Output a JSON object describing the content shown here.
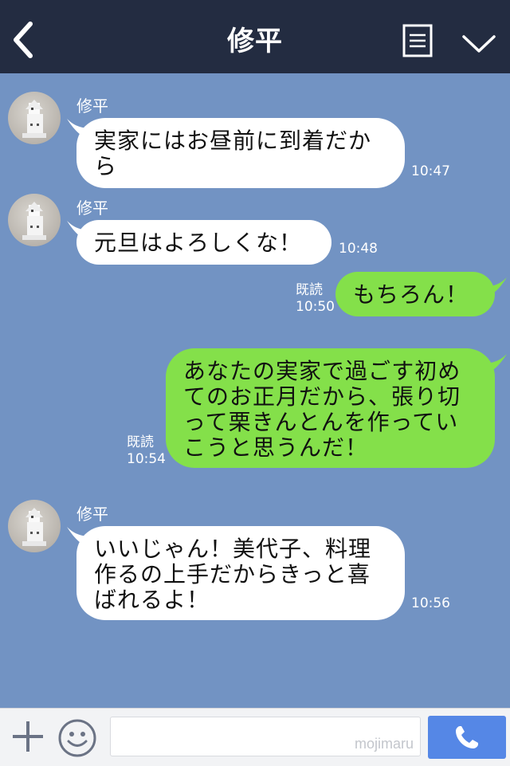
{
  "header": {
    "title": "修平",
    "back_icon": "chevron-left-icon",
    "menu_icon": "memo-list-icon",
    "collapse_icon": "chevron-down-icon",
    "background": "#232c41"
  },
  "chat": {
    "background": "#7293c3",
    "messages": [
      {
        "direction": "in",
        "sender": "修平",
        "lines": [
          "実家にはお昼前に到着だか",
          "ら"
        ],
        "time": "10:47"
      },
      {
        "direction": "in",
        "sender": "修平",
        "lines": [
          "元旦はよろしくな！"
        ],
        "time": "10:48"
      },
      {
        "direction": "out",
        "read": "既読",
        "lines": [
          "もちろん！"
        ],
        "time": "10:50"
      },
      {
        "direction": "out",
        "read": "既読",
        "lines": [
          "あなたの実家で過ごす初め",
          "てのお正月だから、張り切",
          "って栗きんとんを作ってい",
          "こうと思うんだ！"
        ],
        "time": "10:54"
      },
      {
        "direction": "in",
        "sender": "修平",
        "lines": [
          "いいじゃん！美代子、料理",
          "作るの上手だからきっと喜",
          "ばれるよ！"
        ],
        "time": "10:56"
      }
    ],
    "colors": {
      "incoming": "#ffffff",
      "outgoing": "#84e04a"
    }
  },
  "input_bar": {
    "plus_icon": "plus-icon",
    "emoji_icon": "smiley-icon",
    "call_icon": "phone-icon",
    "watermark": "mojimaru",
    "call_color": "#5587e6"
  }
}
